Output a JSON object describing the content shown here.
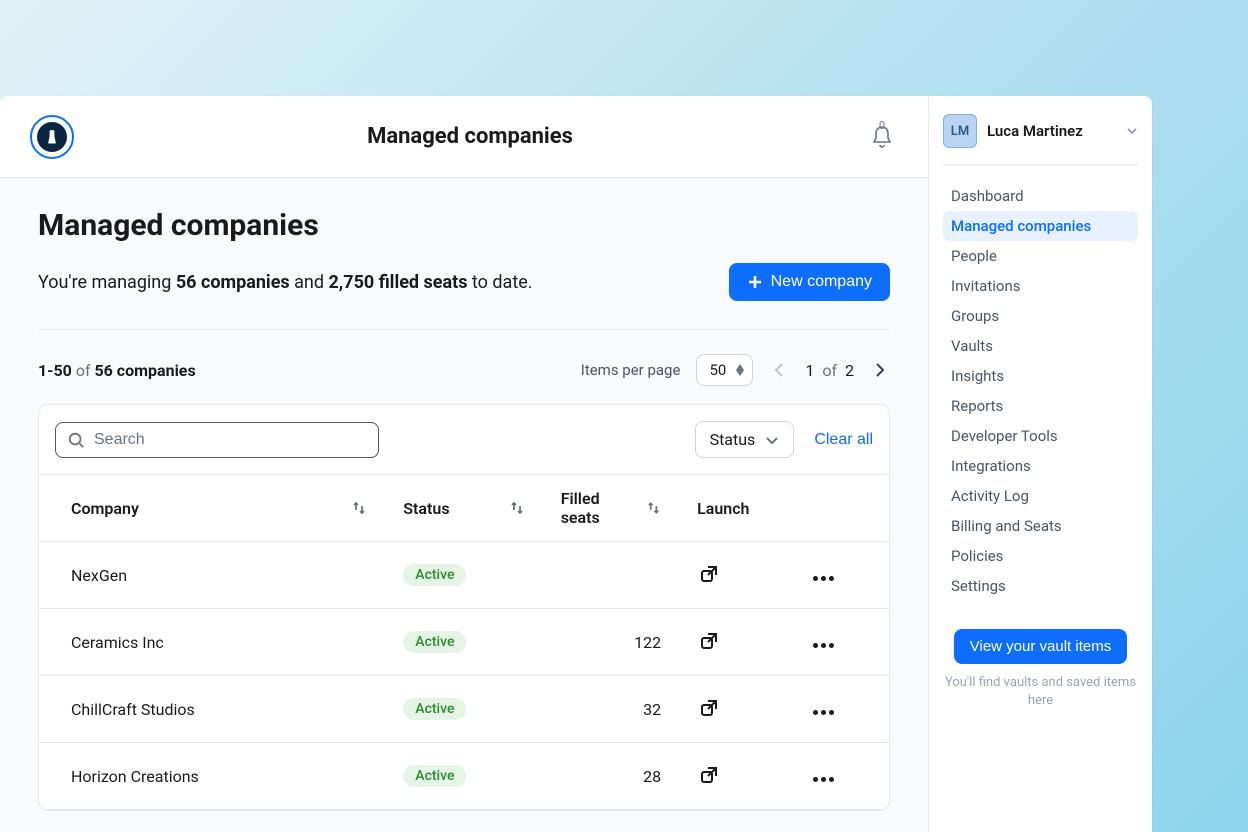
{
  "header": {
    "title": "Managed companies",
    "notification_count": "0"
  },
  "page": {
    "title": "Managed companies",
    "summary_prefix": "You're managing ",
    "summary_companies": "56 companies",
    "summary_mid": " and ",
    "summary_seats": "2,750 filled seats",
    "summary_suffix": " to date.",
    "new_company_label": "New company"
  },
  "pagination": {
    "range": "1-50",
    "of_label": "of",
    "total_label": "56 companies",
    "items_per_page_label": "Items per page",
    "page_size": "50",
    "current_page": "1",
    "total_pages": "2"
  },
  "filters": {
    "search_placeholder": "Search",
    "status_label": "Status",
    "clear_all_label": "Clear all"
  },
  "table": {
    "columns": {
      "company": "Company",
      "status": "Status",
      "filled_seats": "Filled seats",
      "launch": "Launch"
    },
    "status_active_label": "Active",
    "rows": [
      {
        "company": "NexGen",
        "status": "Active",
        "seats": ""
      },
      {
        "company": "Ceramics Inc",
        "status": "Active",
        "seats": "122"
      },
      {
        "company": "ChillCraft Studios",
        "status": "Active",
        "seats": "32"
      },
      {
        "company": "Horizon Creations",
        "status": "Active",
        "seats": "28"
      }
    ]
  },
  "sidebar": {
    "user_initials": "LM",
    "user_name": "Luca Martinez",
    "nav": [
      {
        "label": "Dashboard",
        "active": false
      },
      {
        "label": "Managed companies",
        "active": true
      },
      {
        "label": "People",
        "active": false
      },
      {
        "label": "Invitations",
        "active": false
      },
      {
        "label": "Groups",
        "active": false
      },
      {
        "label": "Vaults",
        "active": false
      },
      {
        "label": "Insights",
        "active": false
      },
      {
        "label": "Reports",
        "active": false
      },
      {
        "label": "Developer Tools",
        "active": false
      },
      {
        "label": "Integrations",
        "active": false
      },
      {
        "label": "Activity Log",
        "active": false
      },
      {
        "label": "Billing and Seats",
        "active": false
      },
      {
        "label": "Policies",
        "active": false
      },
      {
        "label": "Settings",
        "active": false
      }
    ],
    "cta_label": "View your vault items",
    "cta_hint": "You'll find vaults and saved items here"
  }
}
